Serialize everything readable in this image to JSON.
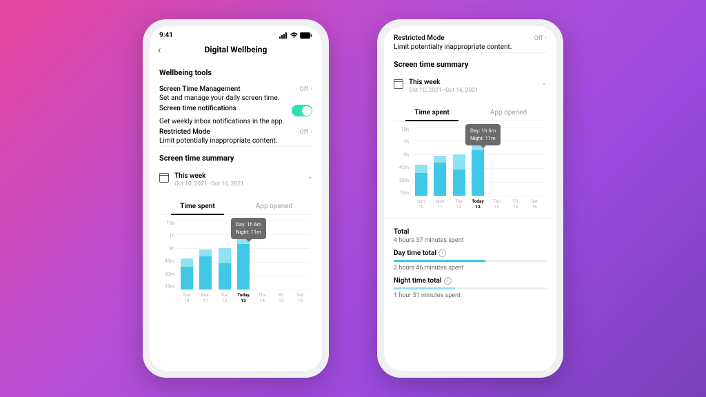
{
  "statusbar": {
    "time": "9:41"
  },
  "header": {
    "title": "Digital Wellbeing"
  },
  "sections": {
    "tools_title": "Wellbeing tools",
    "screen_time_mgmt": {
      "label": "Screen Time Management",
      "sub": "Set and manage your daily screen time.",
      "value": "Off"
    },
    "notifications": {
      "label": "Screen time notifications",
      "sub": "Get weekly inbox notifications in the app."
    },
    "restricted": {
      "label": "Restricted Mode",
      "sub": "Limit potentially inappropriate content.",
      "value": "Off"
    }
  },
  "summary": {
    "title": "Screen time summary",
    "week_label": "This week",
    "date_range": "Oct 10, 2021–Oct 16, 2021",
    "tabs": {
      "time_spent": "Time spent",
      "app_opened": "App opened"
    },
    "tooltip": {
      "day": "Day: 1h  6m",
      "night": "Night: 11m"
    }
  },
  "totals": {
    "total_label": "Total",
    "total_value": "4 hours 37 minutes spent",
    "day_label": "Day time total",
    "day_value": "2 hours 46 minutes spent",
    "night_label": "Night time total",
    "night_value": "1 hour 51 minutes spent"
  },
  "chart_data": {
    "type": "bar",
    "title": "Time spent",
    "xlabel": "",
    "ylabel": "",
    "categories": [
      "Sun 10",
      "Mon 11",
      "Tue 12",
      "Today 13",
      "Thu 14",
      "Fri 15",
      "Sat 16"
    ],
    "y_ticks": [
      "15h",
      "1h",
      "9h",
      "45m",
      "30m",
      "15m"
    ],
    "series": [
      {
        "name": "Day",
        "values": [
          33,
          48,
          38,
          66,
          0,
          0,
          0
        ]
      },
      {
        "name": "Night",
        "values": [
          12,
          10,
          22,
          11,
          0,
          0,
          0
        ]
      }
    ],
    "tooltip_index": 3,
    "annotations": {
      "day": "Day: 1h  6m",
      "night": "Night: 11m"
    }
  }
}
